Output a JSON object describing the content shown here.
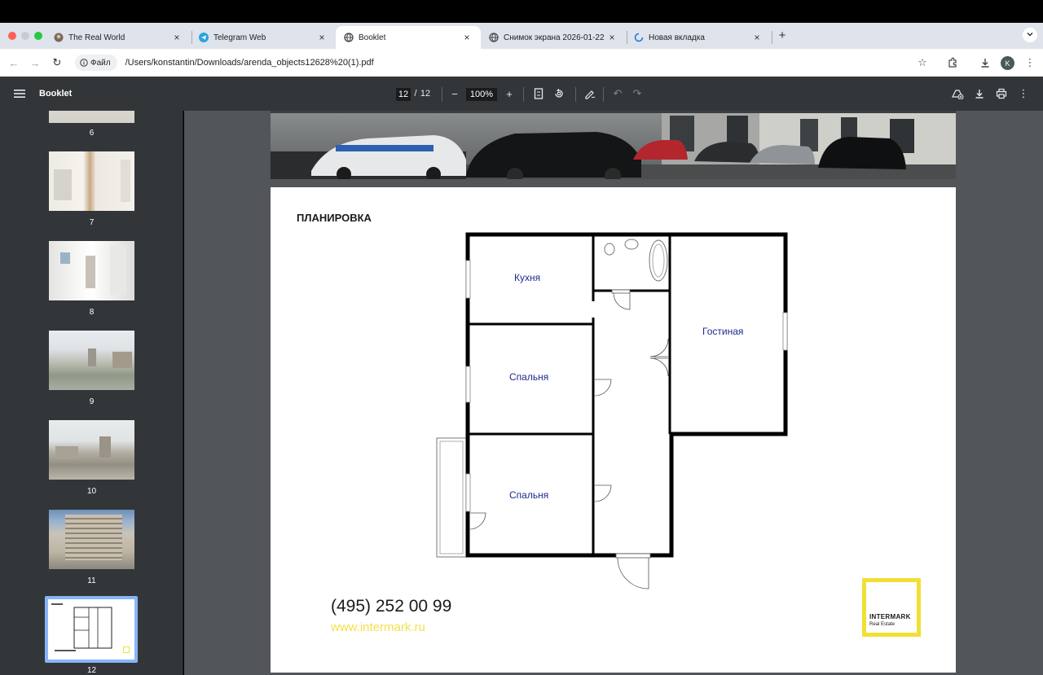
{
  "tabs": [
    {
      "label": "The Real World",
      "icon": "avatar-icon",
      "active": false
    },
    {
      "label": "Telegram Web",
      "icon": "telegram-icon",
      "active": false
    },
    {
      "label": "Booklet",
      "icon": "globe-icon",
      "active": true
    },
    {
      "label": "Снимок экрана 2026-01-22",
      "icon": "globe-icon",
      "active": false
    },
    {
      "label": "Новая вкладка",
      "icon": "loading-icon",
      "active": false
    }
  ],
  "address": {
    "chip_label": "Файл",
    "url": "/Users/konstantin/Downloads/arenda_objects12628%20(1).pdf",
    "profile_initial": "K"
  },
  "pdf": {
    "title": "Booklet",
    "current_page": "12",
    "page_separator": "/",
    "total_pages": "12",
    "zoom": "100%"
  },
  "thumbnails": [
    {
      "number": "6"
    },
    {
      "number": "7"
    },
    {
      "number": "8"
    },
    {
      "number": "9"
    },
    {
      "number": "10"
    },
    {
      "number": "11"
    },
    {
      "number": "12",
      "selected": true
    }
  ],
  "page": {
    "heading": "ПЛАНИРОВКА",
    "rooms": {
      "kitchen": "Кухня",
      "living": "Гостиная",
      "bedroom1": "Спальня",
      "bedroom2": "Спальня"
    },
    "phone": "(495) 252 00 99",
    "website": "www.intermark.ru",
    "logo_name": "INTERMARK",
    "logo_sub": "Real Estate"
  },
  "colors": {
    "accent_yellow": "#f2df34",
    "room_label": "#1e2a8a",
    "pdf_toolbar": "#323639",
    "viewer_bg": "#525659"
  }
}
